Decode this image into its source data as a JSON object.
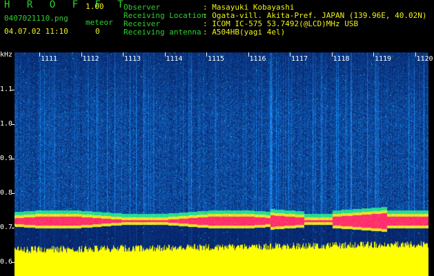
{
  "app": {
    "title": "H R O F F T",
    "version": "1.00"
  },
  "file": {
    "name": "0407021110.png",
    "datetime": "04.07.02 11:10"
  },
  "meteor": {
    "label": "meteor",
    "count": "0"
  },
  "info": {
    "observer_label": "Observer",
    "observer_value": ": Masayuki Kobayashi",
    "location_label": "Receiving Location",
    "location_value": ": Ogata-vill. Akita-Pref. JAPAN (139.96E, 40.02N)",
    "receiver_label": "Receiver",
    "receiver_value": ": ICOM IC-575 53.7492(@LCD)MHz USB",
    "antenna_label": "Receiving antenna",
    "antenna_value": ": A504HB(yagi 4el)"
  },
  "yaxis": {
    "unit": "kHz",
    "ticks": [
      "1.1",
      "1.0",
      "0.9",
      "0.8",
      "0.7",
      "0.6"
    ]
  },
  "xaxis": {
    "minutes": [
      "1111",
      "1112",
      "1113",
      "1114",
      "1115",
      "1116",
      "1117",
      "1118",
      "1119",
      "1120"
    ]
  },
  "colors": {
    "background": "#000000",
    "label_green": "#2fd12f",
    "value_yellow": "#f2f21a",
    "noise_blue": "#0a1f8c",
    "carrier_red": "#ff1a5a",
    "power_yellow": "#ffff00"
  }
}
